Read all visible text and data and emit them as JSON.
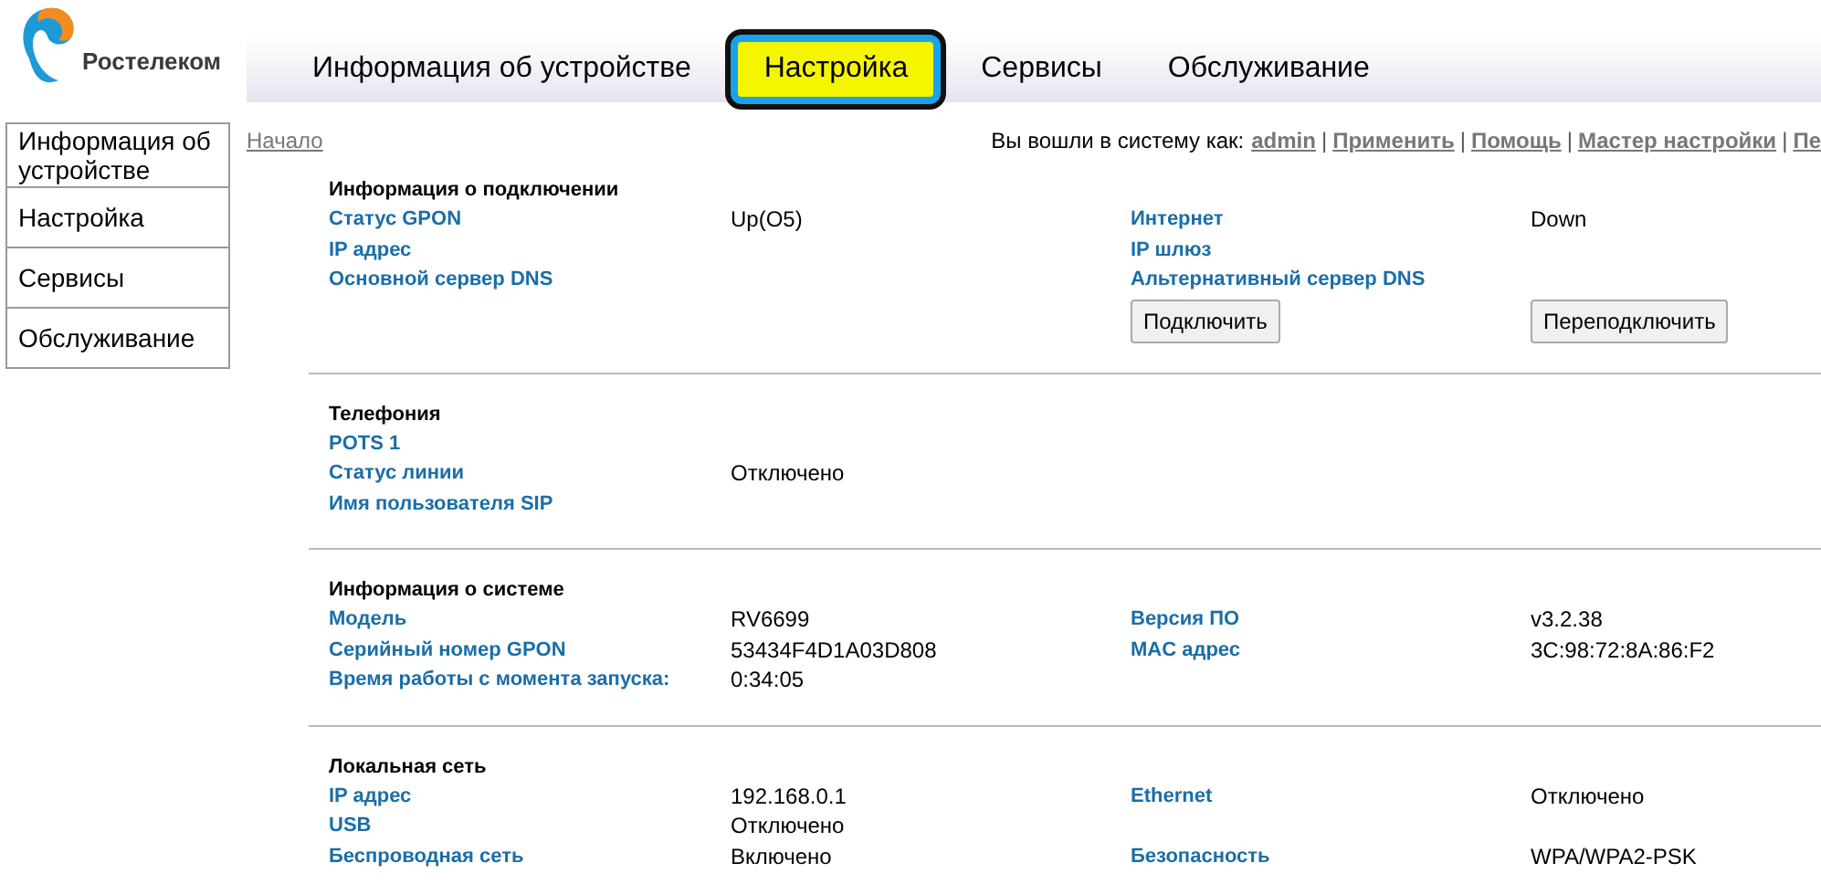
{
  "logo": {
    "text": "Ростелеком"
  },
  "tabs": [
    {
      "label": "Информация об устройстве",
      "selected": false
    },
    {
      "label": "Настройка",
      "selected": true
    },
    {
      "label": "Сервисы",
      "selected": false
    },
    {
      "label": "Обслуживание",
      "selected": false
    }
  ],
  "sidebar": {
    "items": [
      {
        "label": "Информация об устройстве"
      },
      {
        "label": "Настройка"
      },
      {
        "label": "Сервисы"
      },
      {
        "label": "Обслуживание"
      }
    ]
  },
  "breadcrumb": "Начало",
  "login": {
    "prefix": "Вы вошли в систему как:",
    "separator": "|",
    "links": [
      "admin",
      "Применить",
      "Помощь",
      "Мастер настройки",
      "Пе"
    ]
  },
  "sections": [
    {
      "title": "Информация о подключении",
      "rows": [
        {
          "label": "Статус GPON",
          "value": "Up(O5)",
          "label2": "Интернет",
          "value2": "Down"
        },
        {
          "label": "IP адрес",
          "label2": "IP шлюз"
        },
        {
          "label": "Основной сервер DNS",
          "label2": "Альтернативный сервер DNS"
        }
      ],
      "buttons": [
        "Подключить",
        "Переподключить"
      ]
    },
    {
      "title": "Телефония",
      "rows": [
        {
          "label": "POTS 1"
        },
        {
          "label": "Статус линии",
          "value": "Отключено"
        },
        {
          "label": "Имя пользователя SIP"
        }
      ]
    },
    {
      "title": "Информация о системе",
      "rows": [
        {
          "label": "Модель",
          "value": "RV6699",
          "label2": "Версия ПО",
          "value2": "v3.2.38"
        },
        {
          "label": "Серийный номер GPON",
          "value": "53434F4D1A03D808",
          "label2": "MAC адрес",
          "value2": "3C:98:72:8A:86:F2"
        },
        {
          "label": "Время работы с момента запуска:",
          "value": "0:34:05"
        }
      ]
    },
    {
      "title": "Локальная сеть",
      "rows": [
        {
          "label": "IP адрес",
          "value": "192.168.0.1",
          "label2": "Ethernet",
          "value2": "Отключено"
        },
        {
          "label": "USB",
          "value": "Отключено"
        },
        {
          "label": "Беспроводная сеть",
          "value": "Включено",
          "label2": "Безопасность",
          "value2": "WPA/WPA2-PSK"
        }
      ]
    }
  ]
}
